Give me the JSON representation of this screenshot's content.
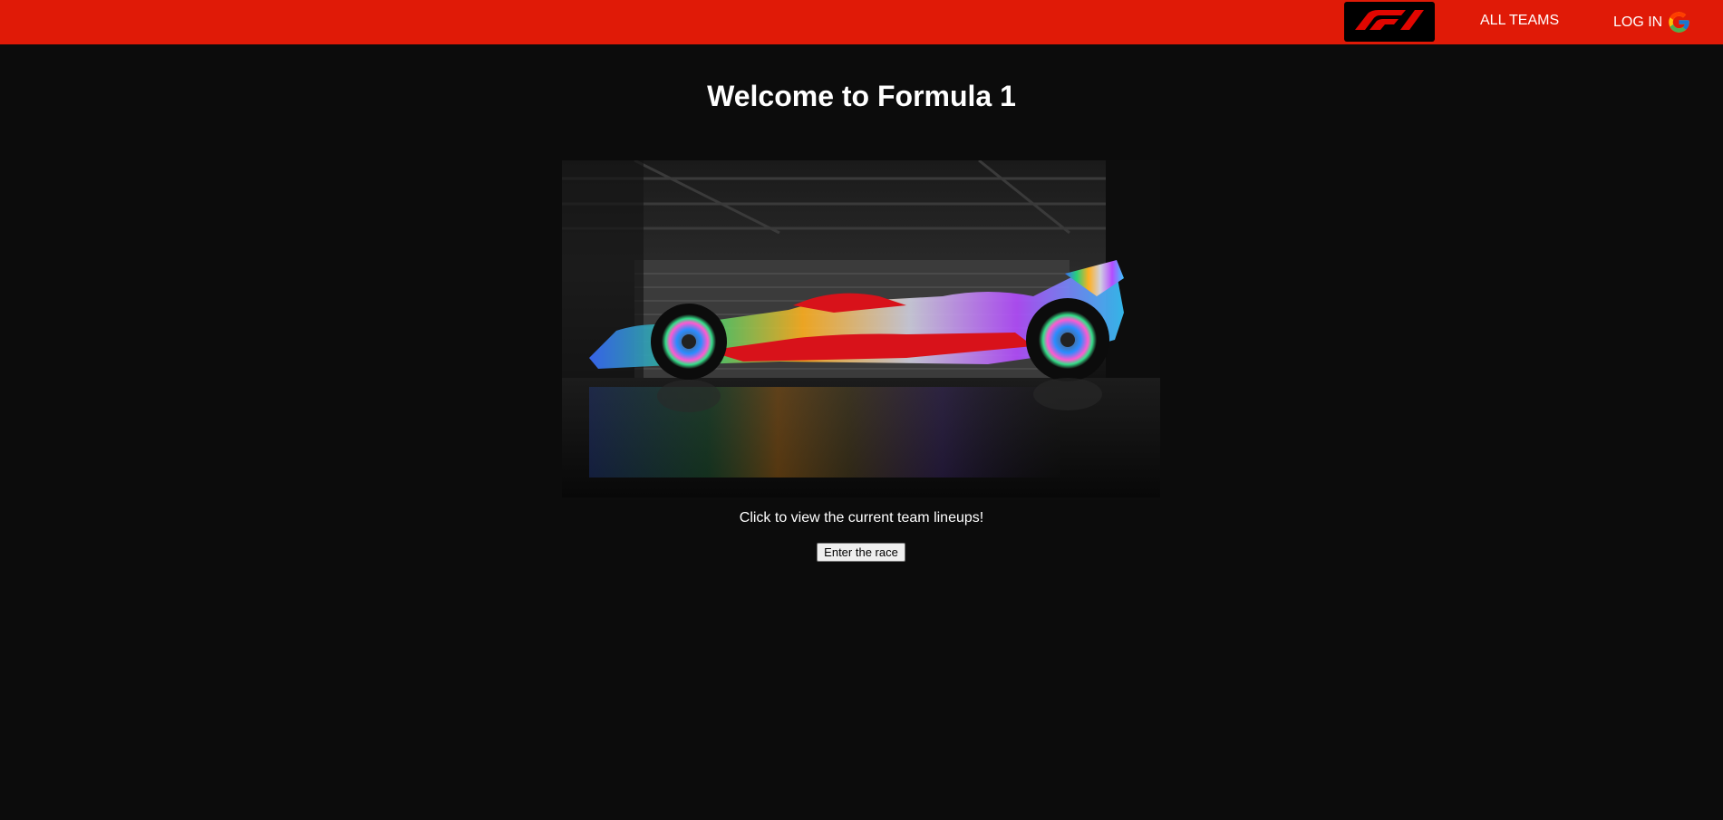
{
  "navbar": {
    "logo_icon": "f1-logo-icon",
    "all_teams_label": "ALL TEAMS",
    "login_label": "LOG IN",
    "login_icon": "google-icon",
    "background_color": "#e01a07"
  },
  "main": {
    "title": "Welcome to Formula 1",
    "hero_image": "f1-car-holographic-garage",
    "subtitle": "Click to view the current team lineups!",
    "enter_button_label": "Enter the race"
  },
  "colors": {
    "page_background": "#0c0c0c",
    "accent": "#e01a07",
    "text": "#ffffff"
  }
}
